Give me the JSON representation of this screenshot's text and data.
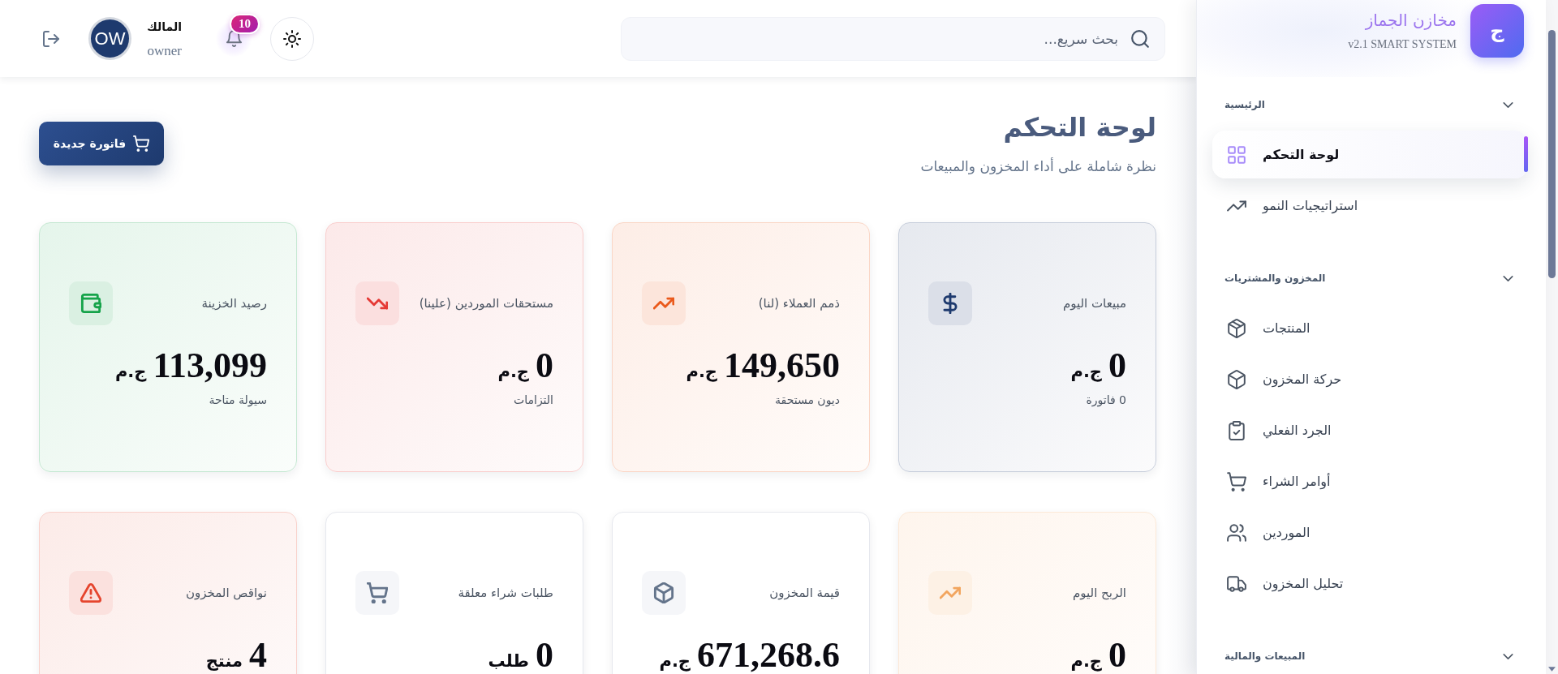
{
  "sidebar": {
    "brand": {
      "logo_letter": "ج",
      "title": "مخازن الجماز",
      "subtitle": "v2.1 SMART SYSTEM"
    },
    "sections": [
      {
        "label": "الرئيسية",
        "expanded": true,
        "items": [
          {
            "label": "لوحة التحكم",
            "selected": true
          },
          {
            "label": "استراتيجيات النمو",
            "selected": false
          }
        ]
      },
      {
        "label": "المخزون والمشتريات",
        "expanded": true,
        "items": [
          {
            "label": "المنتجات",
            "selected": false
          },
          {
            "label": "حركة المخزون",
            "selected": false
          },
          {
            "label": "الجرد الفعلي",
            "selected": false
          },
          {
            "label": "أوامر الشراء",
            "selected": false
          },
          {
            "label": "الموردين",
            "selected": false
          },
          {
            "label": "تحليل المخزون",
            "selected": false
          }
        ]
      },
      {
        "label": "المبيعات والمالية",
        "expanded": true
      }
    ]
  },
  "top_bar": {
    "search": {
      "placeholder": "بحث سريع..."
    },
    "notifications": {
      "badge": "10"
    },
    "user": {
      "avatar_initials": "OW",
      "name": "المالك",
      "role": "owner"
    }
  },
  "page_header": {
    "title": "لوحة التحكم",
    "subtitle": "نظرة شاملة على أداء المخزون والمبيعات",
    "new_invoice_button": "فاتورة جديدة"
  },
  "stat_cards": [
    {
      "label": "مبيعات اليوم",
      "value": "0",
      "unit": "ج.م",
      "note": "0 فاتورة",
      "color": "#1e3a6e",
      "tinted": true
    },
    {
      "label": "ذمم العملاء (لنا)",
      "value": "149,650",
      "unit": "ج.م",
      "note": "ديون مستحقة",
      "color": "#ea5a1c",
      "tinted": true
    },
    {
      "label": "مستحقات الموردين (علينا)",
      "value": "0",
      "unit": "ج.م",
      "note": "التزامات",
      "color": "#e53935",
      "tinted": true
    },
    {
      "label": "رصيد الخزينة",
      "value": "113,099",
      "unit": "ج.م",
      "note": "سيولة متاحة",
      "color": "#16a34a",
      "tinted": true
    },
    {
      "label": "الربح اليوم",
      "value": "0",
      "unit": "ج.م",
      "color": "#f2a55e",
      "tinted": true
    },
    {
      "label": "قيمة المخزون",
      "value": "671,268.6",
      "unit": "ج.م",
      "color": "#64748b",
      "tinted": false
    },
    {
      "label": "طلبات شراء معلقة",
      "value": "0",
      "unit": "طلب",
      "color": "#64748b",
      "tinted": false
    },
    {
      "label": "نواقص المخزون",
      "value": "4",
      "unit": "منتج",
      "color": "#e5452e",
      "tinted": true
    }
  ]
}
